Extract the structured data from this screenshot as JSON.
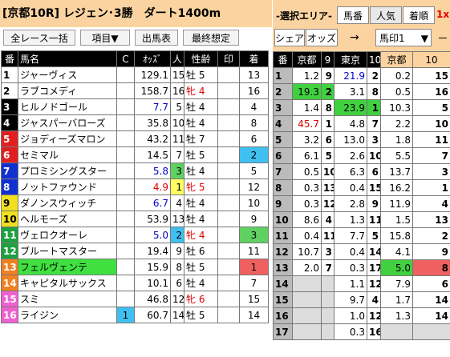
{
  "race_title": "[京都10R] レジェン･3勝　ダート1400m",
  "toolbar": {
    "all_race": "全レース一括",
    "items": "項目▼",
    "card": "出馬表",
    "final": "最終想定"
  },
  "left_header": [
    "番",
    "馬名",
    "C",
    "ｵｯｽﾞ",
    "人",
    "性齢",
    "印",
    "着"
  ],
  "horses": [
    {
      "n": "1",
      "name": "ジャーヴィス",
      "c": "",
      "odds": "129.1",
      "pop": "15",
      "sex": "牡",
      "age": "5",
      "mark": "",
      "fin": "13",
      "num_bg": "#ffffff",
      "num_fg": "#000000",
      "odds_color": "#000000",
      "pop_bg": "",
      "sex_color": "#000000",
      "fin_bg": "",
      "name_bg": ""
    },
    {
      "n": "2",
      "name": "ラブコメディ",
      "c": "",
      "odds": "158.7",
      "pop": "16",
      "sex": "牝",
      "age": "4",
      "mark": "",
      "fin": "16",
      "num_bg": "#ffffff",
      "num_fg": "#000000",
      "odds_color": "#000000",
      "pop_bg": "",
      "sex_color": "#e00000",
      "fin_bg": "",
      "name_bg": ""
    },
    {
      "n": "3",
      "name": "ヒルノドゴール",
      "c": "",
      "odds": "7.7",
      "pop": "5",
      "sex": "牡",
      "age": "4",
      "mark": "",
      "fin": "4",
      "num_bg": "#000000",
      "num_fg": "#ffffff",
      "odds_color": "#0000cc",
      "pop_bg": "",
      "sex_color": "#000000",
      "fin_bg": "",
      "name_bg": ""
    },
    {
      "n": "4",
      "name": "ジャスパーバローズ",
      "c": "",
      "odds": "35.8",
      "pop": "10",
      "sex": "牡",
      "age": "4",
      "mark": "",
      "fin": "8",
      "num_bg": "#000000",
      "num_fg": "#ffffff",
      "odds_color": "#000000",
      "pop_bg": "",
      "sex_color": "#000000",
      "fin_bg": "",
      "name_bg": ""
    },
    {
      "n": "5",
      "name": "ジョディーズマロン",
      "c": "",
      "odds": "43.2",
      "pop": "11",
      "sex": "牡",
      "age": "7",
      "mark": "",
      "fin": "6",
      "num_bg": "#e02020",
      "num_fg": "#ffffff",
      "odds_color": "#000000",
      "pop_bg": "",
      "sex_color": "#000000",
      "fin_bg": "",
      "name_bg": ""
    },
    {
      "n": "6",
      "name": "セミマル",
      "c": "",
      "odds": "14.5",
      "pop": "7",
      "sex": "牡",
      "age": "5",
      "mark": "",
      "fin": "2",
      "num_bg": "#e02020",
      "num_fg": "#ffffff",
      "odds_color": "#000000",
      "pop_bg": "",
      "sex_color": "#000000",
      "fin_bg": "#40c0f0",
      "name_bg": ""
    },
    {
      "n": "7",
      "name": "プロミシングスター",
      "c": "",
      "odds": "5.8",
      "pop": "3",
      "sex": "牡",
      "age": "4",
      "mark": "",
      "fin": "5",
      "num_bg": "#1030d0",
      "num_fg": "#ffffff",
      "odds_color": "#0000cc",
      "pop_bg": "#60d060",
      "sex_color": "#000000",
      "fin_bg": "",
      "name_bg": ""
    },
    {
      "n": "8",
      "name": "ノットファウンド",
      "c": "",
      "odds": "4.9",
      "pop": "1",
      "sex": "牝",
      "age": "5",
      "mark": "",
      "fin": "12",
      "num_bg": "#1030d0",
      "num_fg": "#ffffff",
      "odds_color": "#e00000",
      "pop_bg": "#ffff60",
      "sex_color": "#e00000",
      "fin_bg": "",
      "name_bg": ""
    },
    {
      "n": "9",
      "name": "ダノンスウィッチ",
      "c": "",
      "odds": "6.7",
      "pop": "4",
      "sex": "牡",
      "age": "4",
      "mark": "",
      "fin": "10",
      "num_bg": "#f0e020",
      "num_fg": "#000000",
      "odds_color": "#0000cc",
      "pop_bg": "",
      "sex_color": "#000000",
      "fin_bg": "",
      "name_bg": ""
    },
    {
      "n": "10",
      "name": "ヘルモーズ",
      "c": "",
      "odds": "53.9",
      "pop": "13",
      "sex": "牡",
      "age": "4",
      "mark": "",
      "fin": "9",
      "num_bg": "#f0e020",
      "num_fg": "#000000",
      "odds_color": "#000000",
      "pop_bg": "",
      "sex_color": "#000000",
      "fin_bg": "",
      "name_bg": ""
    },
    {
      "n": "11",
      "name": "ヴェロクオーレ",
      "c": "",
      "odds": "5.0",
      "pop": "2",
      "sex": "牝",
      "age": "4",
      "mark": "",
      "fin": "3",
      "num_bg": "#20a040",
      "num_fg": "#ffffff",
      "odds_color": "#0000cc",
      "pop_bg": "#40c0f0",
      "sex_color": "#e00000",
      "fin_bg": "#60d060",
      "name_bg": ""
    },
    {
      "n": "12",
      "name": "ブルートマスター",
      "c": "",
      "odds": "19.4",
      "pop": "9",
      "sex": "牡",
      "age": "6",
      "mark": "",
      "fin": "11",
      "num_bg": "#20a040",
      "num_fg": "#ffffff",
      "odds_color": "#000000",
      "pop_bg": "",
      "sex_color": "#000000",
      "fin_bg": "",
      "name_bg": ""
    },
    {
      "n": "13",
      "name": "フェルヴェンテ",
      "c": "",
      "odds": "15.9",
      "pop": "8",
      "sex": "牡",
      "age": "5",
      "mark": "",
      "fin": "1",
      "num_bg": "#f08020",
      "num_fg": "#ffffff",
      "odds_color": "#000000",
      "pop_bg": "",
      "sex_color": "#000000",
      "fin_bg": "#f06060",
      "name_bg": "#40e040"
    },
    {
      "n": "14",
      "name": "キャピタルサックス",
      "c": "",
      "odds": "10.1",
      "pop": "6",
      "sex": "牡",
      "age": "4",
      "mark": "",
      "fin": "7",
      "num_bg": "#f08020",
      "num_fg": "#ffffff",
      "odds_color": "#000000",
      "pop_bg": "",
      "sex_color": "#000000",
      "fin_bg": "",
      "name_bg": ""
    },
    {
      "n": "15",
      "name": "スミ",
      "c": "",
      "odds": "46.8",
      "pop": "12",
      "sex": "牝",
      "age": "6",
      "mark": "",
      "fin": "15",
      "num_bg": "#f060d0",
      "num_fg": "#ffffff",
      "odds_color": "#000000",
      "pop_bg": "",
      "sex_color": "#e00000",
      "fin_bg": "",
      "name_bg": ""
    },
    {
      "n": "16",
      "name": "ライジン",
      "c": "1",
      "odds": "60.7",
      "pop": "14",
      "sex": "牡",
      "age": "5",
      "mark": "",
      "fin": "14",
      "num_bg": "#f060d0",
      "num_fg": "#ffffff",
      "odds_color": "#000000",
      "pop_bg": "",
      "sex_color": "#000000",
      "fin_bg": "",
      "name_bg": ""
    }
  ],
  "right_top": {
    "select_area": "-選択エリア-",
    "tab_bano": "馬番",
    "tab_ninki": "人気",
    "tab_chaku": "着順",
    "tab_extra": "1x",
    "share": "シェア",
    "odds": "オッズ",
    "arrow": "→",
    "select_value": "馬印1",
    "select_arrow": "▼",
    "cut_label": "ー"
  },
  "right_header": [
    "番",
    "京都",
    "9",
    "東京",
    "10",
    "京都",
    "10"
  ],
  "right_rows": [
    {
      "n": "1",
      "a": "1.2",
      "b": "9",
      "c": "21.9",
      "d": "2",
      "e": "0.2",
      "f": "15",
      "bg_ab": "",
      "bg_cd": "",
      "bg_ef": "",
      "c_color": "#0000cc"
    },
    {
      "n": "2",
      "a": "19.3",
      "b": "2",
      "c": "3.1",
      "d": "8",
      "e": "0.5",
      "f": "16",
      "bg_ab": "#40d040",
      "bg_cd": "",
      "bg_ef": "",
      "c_color": "#000000"
    },
    {
      "n": "3",
      "a": "1.4",
      "b": "8",
      "c": "23.9",
      "d": "1",
      "e": "10.3",
      "f": "5",
      "bg_ab": "",
      "bg_cd": "#40d040",
      "bg_ef": "",
      "c_color": "#000000"
    },
    {
      "n": "4",
      "a": "45.7",
      "b": "1",
      "c": "4.8",
      "d": "7",
      "e": "2.2",
      "f": "10",
      "bg_ab": "",
      "bg_cd": "",
      "bg_ef": "",
      "c_color": "#000000"
    },
    {
      "n": "5",
      "a": "3.2",
      "b": "6",
      "c": "13.0",
      "d": "3",
      "e": "1.8",
      "f": "11",
      "bg_ab": "",
      "bg_cd": "",
      "bg_ef": "",
      "c_color": "#000000"
    },
    {
      "n": "6",
      "a": "6.1",
      "b": "5",
      "c": "2.6",
      "d": "10",
      "e": "5.5",
      "f": "7",
      "bg_ab": "",
      "bg_cd": "",
      "bg_ef": "",
      "c_color": "#000000"
    },
    {
      "n": "7",
      "a": "0.5",
      "b": "10",
      "c": "6.3",
      "d": "6",
      "e": "13.7",
      "f": "3",
      "bg_ab": "",
      "bg_cd": "",
      "bg_ef": "",
      "c_color": "#000000"
    },
    {
      "n": "8",
      "a": "0.3",
      "b": "13",
      "c": "0.4",
      "d": "15",
      "e": "16.2",
      "f": "1",
      "bg_ab": "",
      "bg_cd": "",
      "bg_ef": "",
      "c_color": "#000000"
    },
    {
      "n": "9",
      "a": "0.3",
      "b": "12",
      "c": "2.8",
      "d": "9",
      "e": "11.9",
      "f": "4",
      "bg_ab": "",
      "bg_cd": "",
      "bg_ef": "",
      "c_color": "#000000"
    },
    {
      "n": "10",
      "a": "8.6",
      "b": "4",
      "c": "1.3",
      "d": "11",
      "e": "1.5",
      "f": "13",
      "bg_ab": "",
      "bg_cd": "",
      "bg_ef": "",
      "c_color": "#000000"
    },
    {
      "n": "11",
      "a": "0.4",
      "b": "11",
      "c": "7.7",
      "d": "5",
      "e": "15.8",
      "f": "2",
      "bg_ab": "",
      "bg_cd": "",
      "bg_ef": "",
      "c_color": "#000000"
    },
    {
      "n": "12",
      "a": "10.7",
      "b": "3",
      "c": "0.4",
      "d": "14",
      "e": "4.1",
      "f": "9",
      "bg_ab": "",
      "bg_cd": "",
      "bg_ef": "",
      "c_color": "#000000"
    },
    {
      "n": "13",
      "a": "2.0",
      "b": "7",
      "c": "0.3",
      "d": "17",
      "e": "5.0",
      "f": "8",
      "bg_ab": "",
      "bg_cd": "",
      "bg_ef": "#40d040",
      "c_color": "#000000"
    },
    {
      "n": "14",
      "a": "",
      "b": "",
      "c": "1.1",
      "d": "12",
      "e": "7.9",
      "f": "6",
      "bg_ab": "#dddddd",
      "bg_cd": "",
      "bg_ef": "",
      "c_color": "#000000"
    },
    {
      "n": "15",
      "a": "",
      "b": "",
      "c": "9.7",
      "d": "4",
      "e": "1.7",
      "f": "14",
      "bg_ab": "#dddddd",
      "bg_cd": "",
      "bg_ef": "",
      "c_color": "#000000"
    },
    {
      "n": "16",
      "a": "",
      "b": "",
      "c": "1.0",
      "d": "12",
      "e": "1.3",
      "f": "14",
      "bg_ab": "#dddddd",
      "bg_cd": "",
      "bg_ef": "",
      "c_color": "#000000"
    },
    {
      "n": "17",
      "a": "",
      "b": "",
      "c": "0.3",
      "d": "16",
      "e": "",
      "f": "",
      "bg_ab": "#dddddd",
      "bg_cd": "",
      "bg_ef": "#dddddd",
      "c_color": "#000000"
    }
  ]
}
